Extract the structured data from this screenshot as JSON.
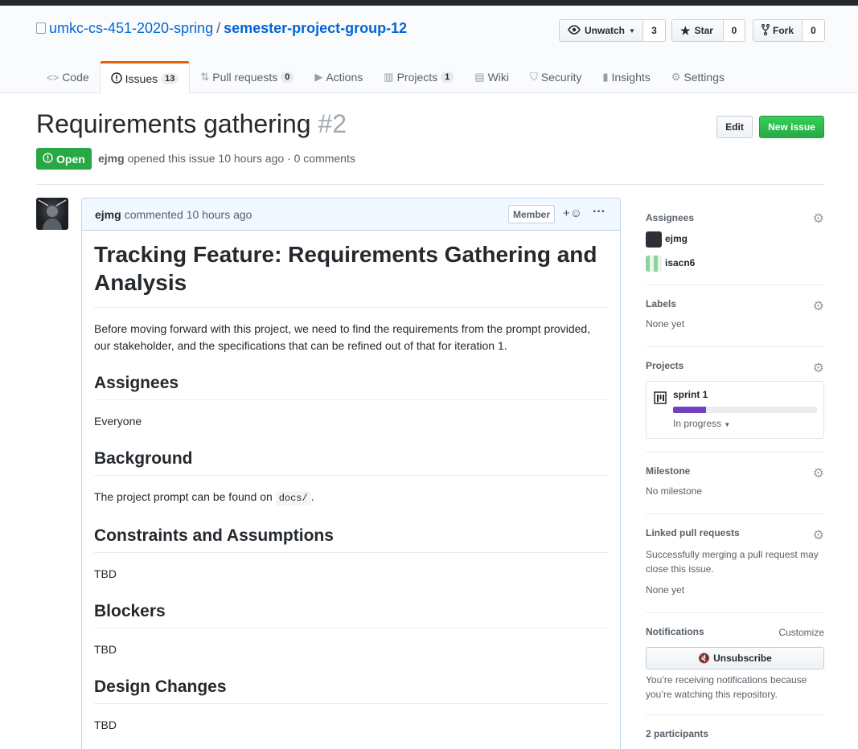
{
  "repo": {
    "owner": "umkc-cs-451-2020-spring",
    "separator": "/",
    "name": "semester-project-group-12"
  },
  "actions": {
    "watch": {
      "label": "Unwatch",
      "count": "3"
    },
    "star": {
      "label": "Star",
      "count": "0"
    },
    "fork": {
      "label": "Fork",
      "count": "0"
    }
  },
  "tabs": [
    {
      "label": "Code",
      "icon": "code-icon"
    },
    {
      "label": "Issues",
      "count": "13",
      "icon": "issue-opened-icon"
    },
    {
      "label": "Pull requests",
      "count": "0",
      "icon": "git-pull-request-icon"
    },
    {
      "label": "Actions",
      "icon": "play-icon"
    },
    {
      "label": "Projects",
      "count": "1",
      "icon": "project-icon"
    },
    {
      "label": "Wiki",
      "icon": "book-icon"
    },
    {
      "label": "Security",
      "icon": "shield-icon"
    },
    {
      "label": "Insights",
      "icon": "graph-icon"
    },
    {
      "label": "Settings",
      "icon": "gear-icon"
    }
  ],
  "issue": {
    "title": "Requirements gathering",
    "number": "#2",
    "state": "Open",
    "author": "ejmg",
    "meta": "opened this issue 10 hours ago · 0 comments",
    "edit_label": "Edit",
    "new_label": "New issue"
  },
  "comment": {
    "author": "ejmg",
    "time": "commented 10 hours ago",
    "badge": "Member",
    "h1": "Tracking Feature: Requirements Gathering and Analysis",
    "intro": "Before moving forward with this project, we need to find the requirements from the prompt provided, our stakeholder, and the specifications that can be refined out of that for iteration 1.",
    "sections": [
      {
        "heading": "Assignees",
        "text": "Everyone"
      },
      {
        "heading": "Background",
        "text_before": "The project prompt can be found on ",
        "code": "docs/",
        "text_after": "."
      },
      {
        "heading": "Constraints and Assumptions",
        "text": "TBD"
      },
      {
        "heading": "Blockers",
        "text": "TBD"
      },
      {
        "heading": "Design Changes",
        "text": "TBD"
      }
    ]
  },
  "sidebar": {
    "assignees": {
      "title": "Assignees",
      "users": [
        "ejmg",
        "isacn6"
      ]
    },
    "labels": {
      "title": "Labels",
      "value": "None yet"
    },
    "projects": {
      "title": "Projects",
      "name": "sprint 1",
      "status": "In progress",
      "progress": 0.23
    },
    "milestone": {
      "title": "Milestone",
      "value": "No milestone"
    },
    "linked": {
      "title": "Linked pull requests",
      "desc": "Successfully merging a pull request may close this issue.",
      "value": "None yet"
    },
    "notifications": {
      "title": "Notifications",
      "customize": "Customize",
      "button": "Unsubscribe",
      "desc": "You’re receiving notifications because you’re watching this repository."
    },
    "participants": "2 participants"
  },
  "colors": {
    "accent": "#0366d6",
    "open": "#28a745",
    "tab_active": "#e36209",
    "progress": "#6f42c1"
  }
}
